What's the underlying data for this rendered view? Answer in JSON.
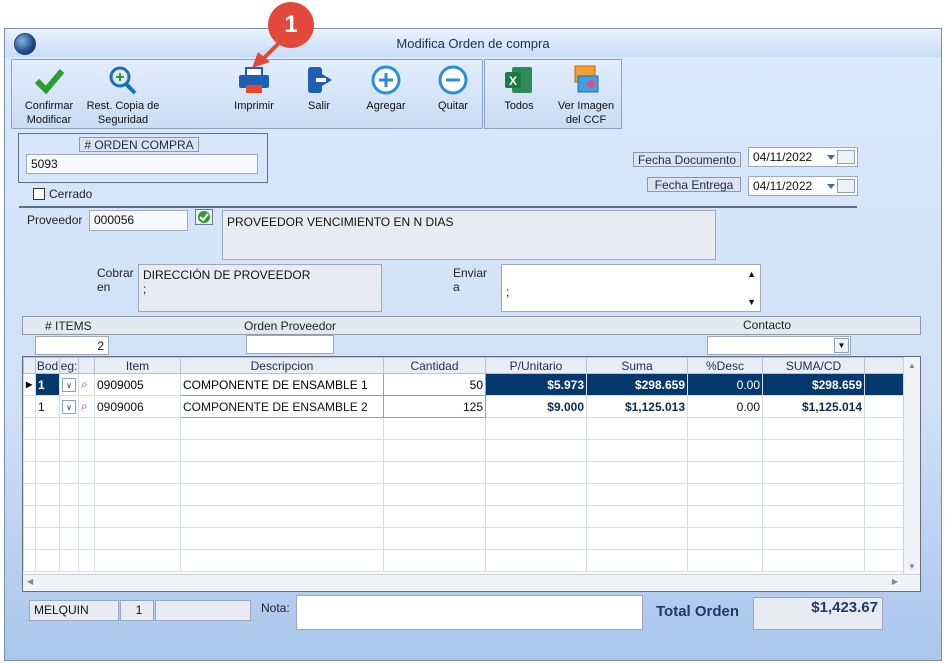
{
  "window": {
    "title": "Modifica Orden de compra"
  },
  "annotation": {
    "badge": "1"
  },
  "toolbar": {
    "confirm_label": "Confirmar Modificar",
    "restore_label": "Rest. Copia de Seguridad",
    "print_label": "Imprimir",
    "exit_label": "Salir",
    "add_label": "Agregar",
    "remove_label": "Quitar",
    "all_label": "Todos",
    "view_image_label": "Ver Imagen del CCF"
  },
  "order": {
    "number_label": "# ORDEN COMPRA",
    "number": "5093",
    "closed_label": "Cerrado",
    "doc_date_label": "Fecha Documento",
    "doc_date": "04/11/2022",
    "delivery_date_label": "Fecha Entrega",
    "delivery_date": "04/11/2022"
  },
  "supplier": {
    "label": "Proveedor",
    "code": "000056",
    "name": "PROVEEDOR VENCIMIENTO EN N DIAS",
    "charge_label": "Cobrar en",
    "charge_line1": "DIRECCIÓN DE PROVEEDOR",
    "charge_line2": ";",
    "send_label": "Enviar a",
    "send_value": ";"
  },
  "summary": {
    "items_label": "# ITEMS",
    "items": "2",
    "supplier_order_label": "Orden Proveedor",
    "supplier_order": "",
    "contact_label": "Contacto",
    "contact": ""
  },
  "grid": {
    "headers": [
      "Bod",
      "eg:",
      "",
      "Item",
      "Descripcion",
      "Cantidad",
      "P/Unitario",
      "Suma",
      "%Desc",
      "SUMA/CD"
    ],
    "rows": [
      {
        "bod": "1",
        "item": "0909005",
        "desc": "COMPONENTE DE ENSAMBLE 1",
        "qty": "50",
        "unit": "$5.973",
        "sum": "$298.659",
        "disc": "0.00",
        "sumcd": "$298.659"
      },
      {
        "bod": "1",
        "item": "0909006",
        "desc": "COMPONENTE DE ENSAMBLE 2",
        "qty": "125",
        "unit": "$9.000",
        "sum": "$1,125.013",
        "disc": "0.00",
        "sumcd": "$1,125.014"
      }
    ]
  },
  "footer": {
    "user": "MELQUIN",
    "station": "1",
    "extra": "",
    "note_label": "Nota:",
    "note": "",
    "total_label": "Total Orden",
    "total": "$1,423.67"
  },
  "colors": {
    "selected_row": "#05396e",
    "annotation": "#e2493b",
    "excel": "#1d7a43",
    "print": "#1e5fb3"
  }
}
